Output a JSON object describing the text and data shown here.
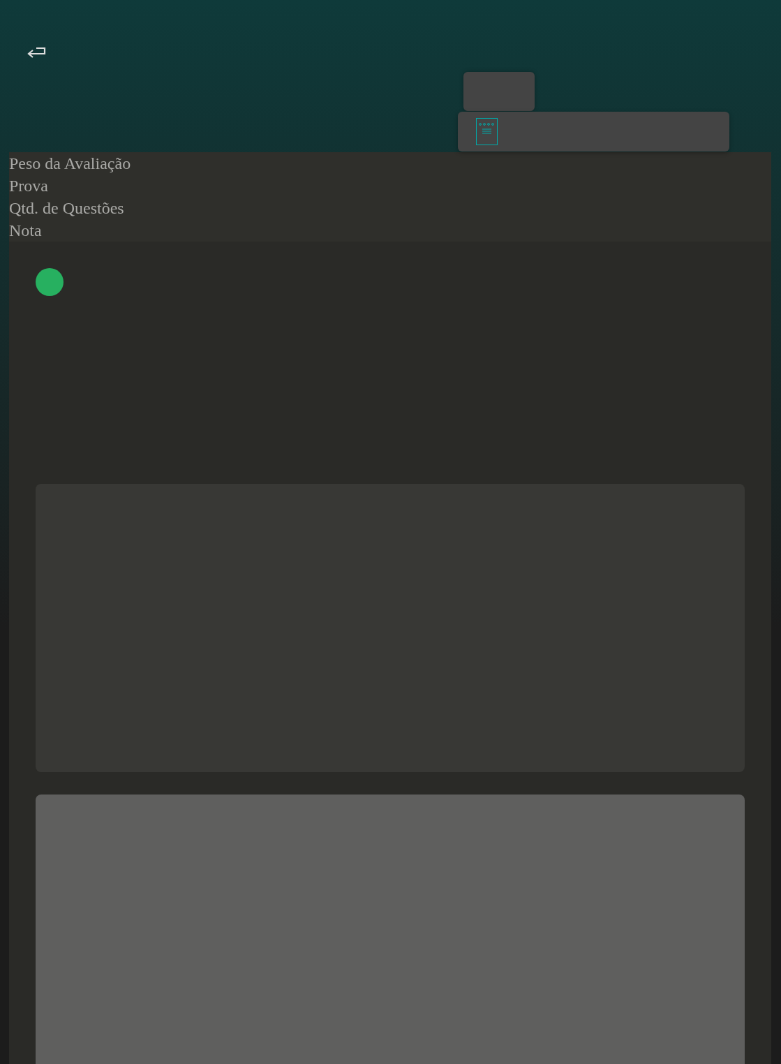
{
  "labels": [
    "Peso da Avaliação",
    "Prova",
    "Qtd. de Questões",
    "Nota"
  ],
  "status_dot": {
    "color": "#27b060"
  }
}
